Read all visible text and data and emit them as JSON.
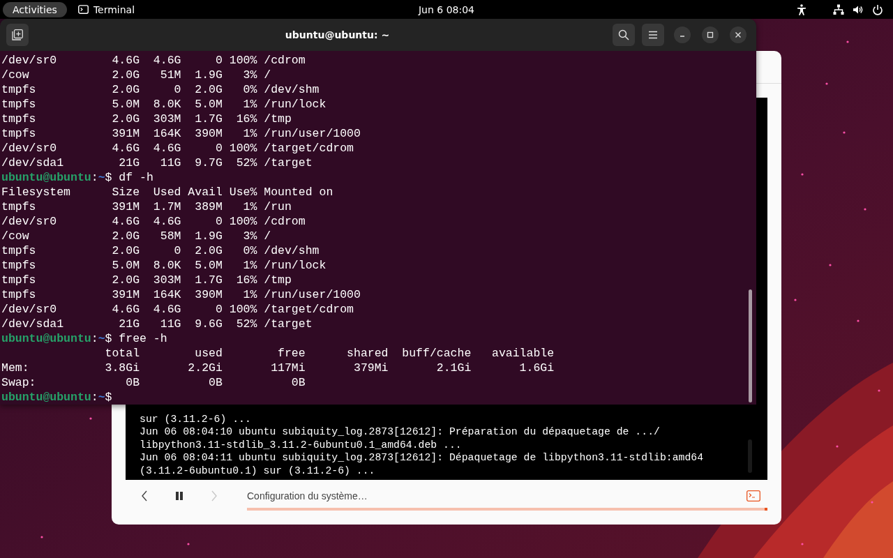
{
  "top_bar": {
    "activities": "Activities",
    "app": "Terminal",
    "clock": "Jun 6  08:04"
  },
  "installer": {
    "log_lines": [
      "sur (3.11.2-6) ...",
      "Jun 06 08:04:10 ubuntu subiquity_log.2873[12612]: Préparation du dépaquetage de .../",
      "libpython3.11-stdlib_3.11.2-6ubuntu0.1_amd64.deb ...",
      "Jun 06 08:04:11 ubuntu subiquity_log.2873[12612]: Dépaquetage de libpython3.11-stdlib:amd64",
      "(3.11.2-6ubuntu0.1) sur (3.11.2-6) ..."
    ],
    "back_disabled": false,
    "forward_disabled": true,
    "status": "Configuration du système…",
    "progress": {
      "level": 1
    }
  },
  "terminal": {
    "title": "ubuntu@ubuntu: ~",
    "lines": [
      {
        "kind": "output",
        "text": "/dev/sr0        4.6G  4.6G     0 100% /cdrom"
      },
      {
        "kind": "output",
        "text": "/cow            2.0G   51M  1.9G   3% /"
      },
      {
        "kind": "output",
        "text": "tmpfs           2.0G     0  2.0G   0% /dev/shm"
      },
      {
        "kind": "output",
        "text": "tmpfs           5.0M  8.0K  5.0M   1% /run/lock"
      },
      {
        "kind": "output",
        "text": "tmpfs           2.0G  303M  1.7G  16% /tmp"
      },
      {
        "kind": "output",
        "text": "tmpfs           391M  164K  390M   1% /run/user/1000"
      },
      {
        "kind": "output",
        "text": "/dev/sr0        4.6G  4.6G     0 100% /target/cdrom"
      },
      {
        "kind": "output",
        "text": "/dev/sda1        21G   11G  9.7G  52% /target"
      },
      {
        "kind": "prompt",
        "user": "ubuntu@ubuntu",
        "sep": ":",
        "path": "~",
        "symbol": "$",
        "command": "df -h"
      },
      {
        "kind": "output",
        "text": "Filesystem      Size  Used Avail Use% Mounted on"
      },
      {
        "kind": "output",
        "text": "tmpfs           391M  1.7M  389M   1% /run"
      },
      {
        "kind": "output",
        "text": "/dev/sr0        4.6G  4.6G     0 100% /cdrom"
      },
      {
        "kind": "output",
        "text": "/cow            2.0G   58M  1.9G   3% /"
      },
      {
        "kind": "output",
        "text": "tmpfs           2.0G     0  2.0G   0% /dev/shm"
      },
      {
        "kind": "output",
        "text": "tmpfs           5.0M  8.0K  5.0M   1% /run/lock"
      },
      {
        "kind": "output",
        "text": "tmpfs           2.0G  303M  1.7G  16% /tmp"
      },
      {
        "kind": "output",
        "text": "tmpfs           391M  164K  390M   1% /run/user/1000"
      },
      {
        "kind": "output",
        "text": "/dev/sr0        4.6G  4.6G     0 100% /target/cdrom"
      },
      {
        "kind": "output",
        "text": "/dev/sda1        21G   11G  9.6G  52% /target"
      },
      {
        "kind": "prompt",
        "user": "ubuntu@ubuntu",
        "sep": ":",
        "path": "~",
        "symbol": "$",
        "command": "free -h"
      },
      {
        "kind": "output",
        "text": "               total        used        free      shared  buff/cache   available"
      },
      {
        "kind": "output",
        "text": "Mem:           3.8Gi       2.2Gi       117Mi       379Mi       2.1Gi       1.6Gi"
      },
      {
        "kind": "output",
        "text": "Swap:             0B          0B          0B"
      },
      {
        "kind": "prompt",
        "user": "ubuntu@ubuntu",
        "sep": ":",
        "path": "~",
        "symbol": "$"
      }
    ]
  }
}
